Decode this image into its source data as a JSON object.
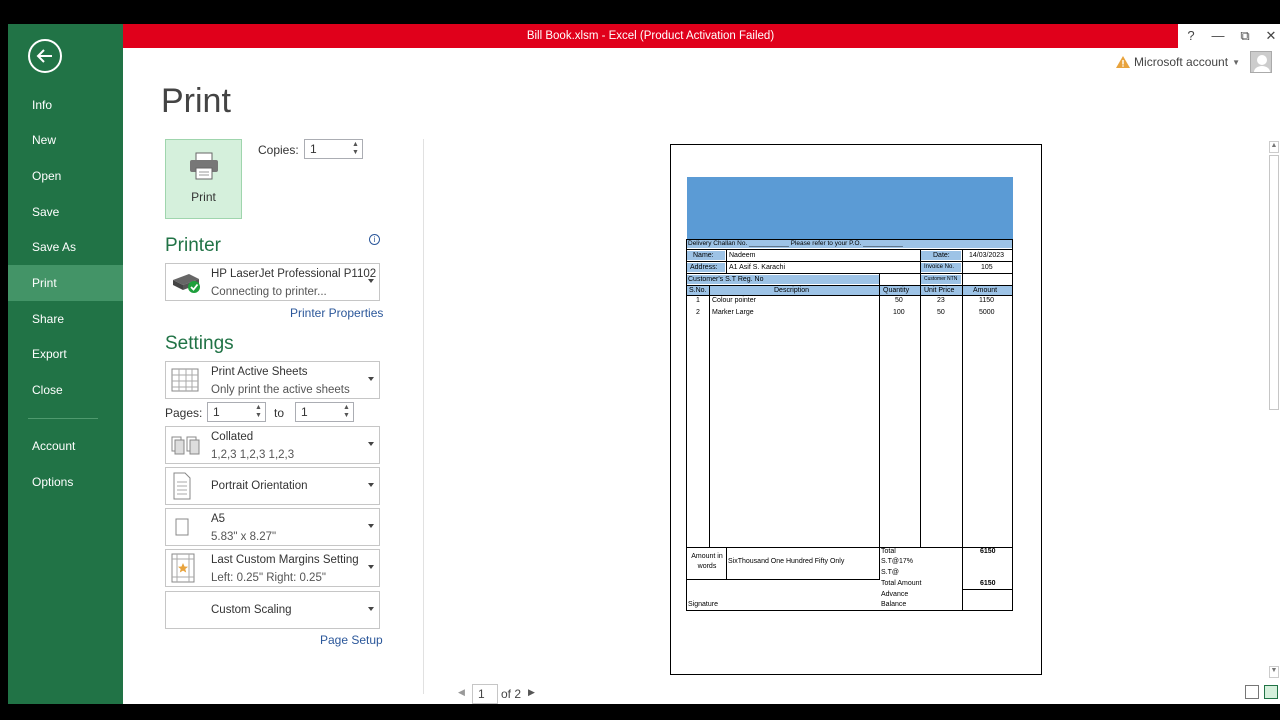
{
  "window": {
    "title": "Bill Book.xlsm -  Excel (Product Activation Failed)",
    "help": "?",
    "minimize": "—",
    "restore": "⧉",
    "close": "✕"
  },
  "account": {
    "label": "Microsoft account"
  },
  "sidebar": {
    "items": [
      {
        "label": "Info"
      },
      {
        "label": "New"
      },
      {
        "label": "Open"
      },
      {
        "label": "Save"
      },
      {
        "label": "Save As"
      },
      {
        "label": "Print"
      },
      {
        "label": "Share"
      },
      {
        "label": "Export"
      },
      {
        "label": "Close"
      },
      {
        "label": "Account"
      },
      {
        "label": "Options"
      }
    ],
    "active": "Print"
  },
  "page": {
    "title": "Print"
  },
  "print_button": {
    "label": "Print"
  },
  "copies": {
    "label": "Copies:",
    "value": "1"
  },
  "printer": {
    "heading": "Printer",
    "name": "HP LaserJet Professional P1102",
    "status": "Connecting to printer...",
    "properties_link": "Printer Properties",
    "info_icon": "i"
  },
  "settings": {
    "heading": "Settings",
    "active_sheets": {
      "title": "Print Active Sheets",
      "sub": "Only print the active sheets"
    },
    "pages": {
      "label": "Pages:",
      "from": "1",
      "to_label": "to",
      "to": "1"
    },
    "collated": {
      "title": "Collated",
      "sub": "1,2,3    1,2,3    1,2,3"
    },
    "orientation": {
      "title": "Portrait Orientation"
    },
    "paper": {
      "title": "A5",
      "sub": "5.83\" x 8.27\""
    },
    "margins": {
      "title": "Last Custom Margins Setting",
      "sub": "Left:  0.25\"    Right:  0.25\""
    },
    "scaling": {
      "title": "Custom Scaling"
    },
    "page_setup_link": "Page Setup"
  },
  "pager": {
    "current": "1",
    "total_label": "of 2"
  },
  "invoice": {
    "delivery_line": "Delivery Challan No. ___________    Please refer to your P.O. ___________",
    "name_label": "Name:",
    "name_value": "Nadeem",
    "date_label": "Date:",
    "date_value": "14/03/2023",
    "address_label": "Address:",
    "address_value": "A1 Asif S. Karachi",
    "invoice_label": "Invoice No.",
    "invoice_value": "105",
    "st_reg_label": "Customer's S.T Reg. No",
    "ntn_label": "Customer NTN",
    "columns": [
      "S.No.",
      "Description",
      "Quantity",
      "Unit Price",
      "Amount"
    ],
    "rows": [
      {
        "sno": "1",
        "desc": "Colour  pointer",
        "qty": "50",
        "price": "23",
        "amount": "1150"
      },
      {
        "sno": "2",
        "desc": "Marker  Large",
        "qty": "100",
        "price": "50",
        "amount": "5000"
      }
    ],
    "amount_words_label": "Amount in words",
    "amount_words": "SixThousand One Hundred Fifty Only",
    "total_label": "Total",
    "total_value": "6150",
    "st17_label": "S.T@17%",
    "st_label": "S.T@",
    "total_amount_label": "Total Amount",
    "total_amount_value": "6150",
    "advance_label": "Advance",
    "balance_label": "Balance",
    "signature_label": "Signature"
  }
}
